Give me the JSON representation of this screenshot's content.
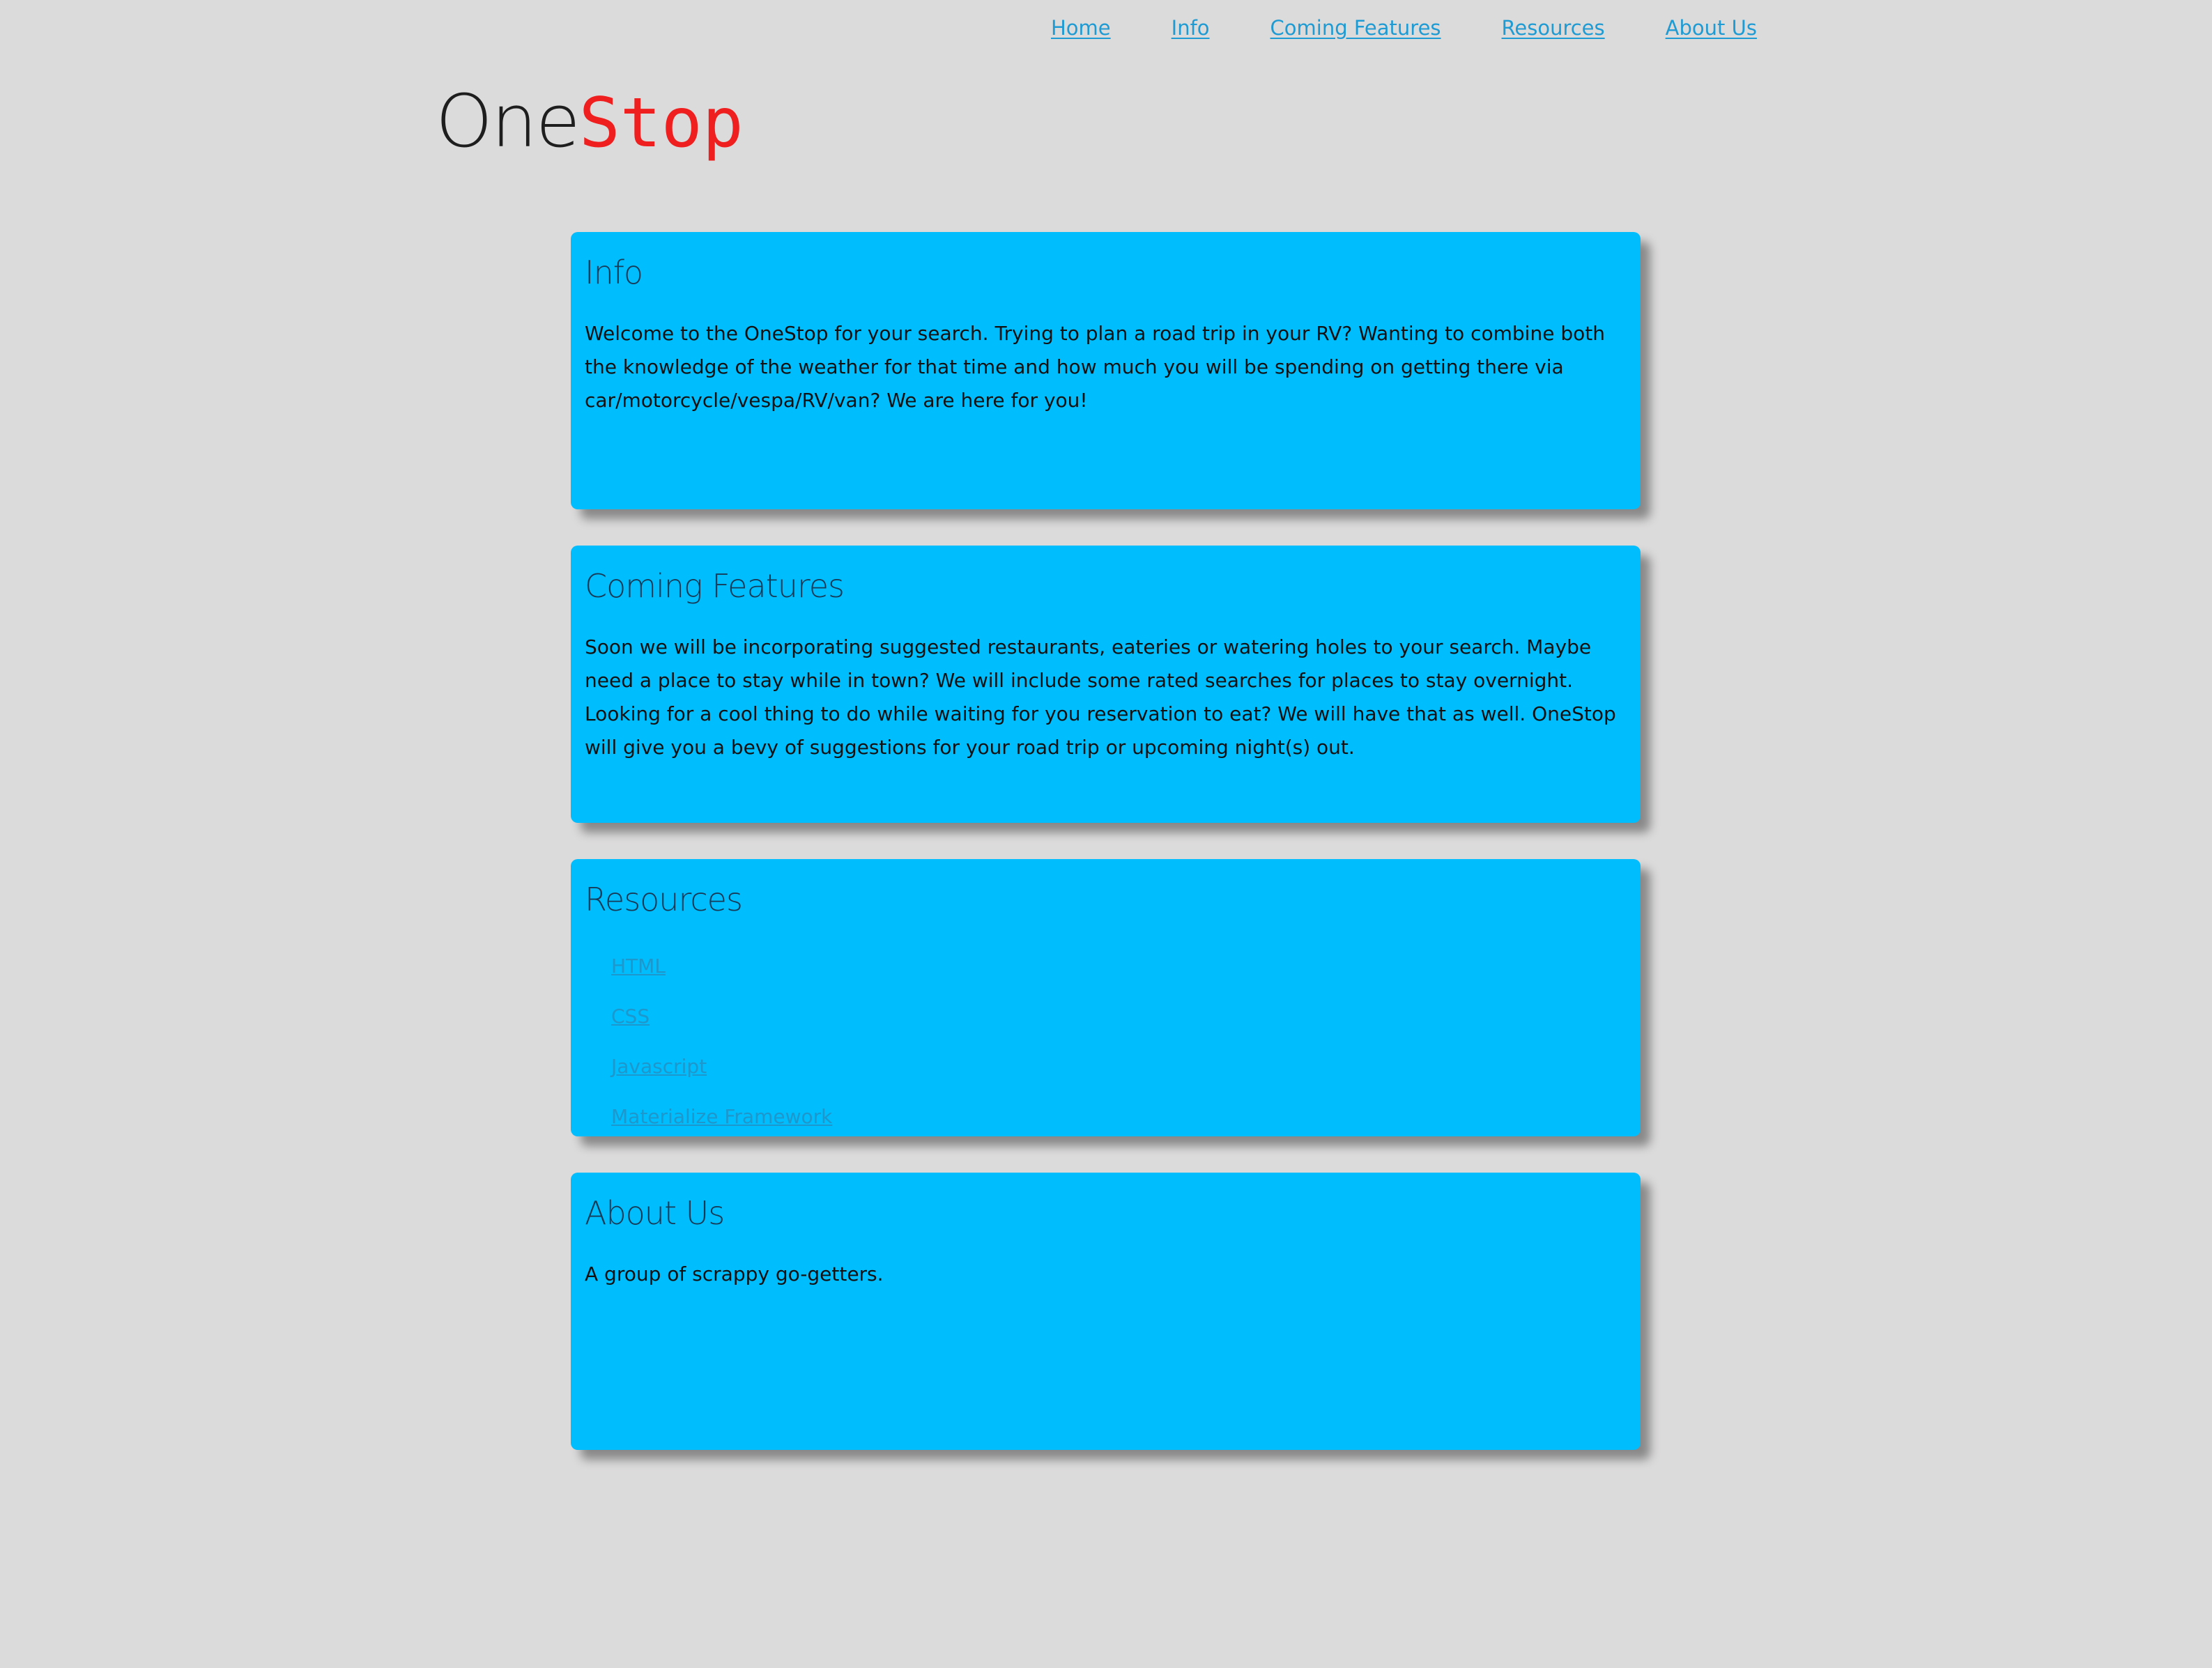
{
  "nav": {
    "items": [
      "Home",
      "Info",
      "Coming Features",
      "Resources",
      "About Us"
    ]
  },
  "logo": {
    "part1": "One",
    "part2": "Stop"
  },
  "sections": {
    "info": {
      "title": "Info",
      "text": "Welcome to the OneStop for your search. Trying to plan a road trip in your RV? Wanting to combine both the knowledge of the weather for that time and how much you will be spending on getting there via car/motorcycle/vespa/RV/van? We are here for you!"
    },
    "coming": {
      "title": "Coming Features",
      "text": "Soon we will be incorporating suggested restaurants, eateries or watering holes to your search. Maybe need a place to stay while in town? We will include some rated searches for places to stay overnight. Looking for a cool thing to do while waiting for you reservation to eat? We will have that as well. OneStop will give you a bevy of suggestions for your road trip or upcoming night(s) out."
    },
    "resources": {
      "title": "Resources",
      "links": [
        "HTML",
        "CSS",
        "Javascript",
        "Materialize Framework"
      ]
    },
    "about": {
      "title": "About Us",
      "text": "A group of scrappy go-getters."
    }
  },
  "colors": {
    "background": "#dcdbdb",
    "panel": "#00bdfd",
    "link": "#1f9bd4",
    "logo_accent": "#ef1f1f"
  }
}
